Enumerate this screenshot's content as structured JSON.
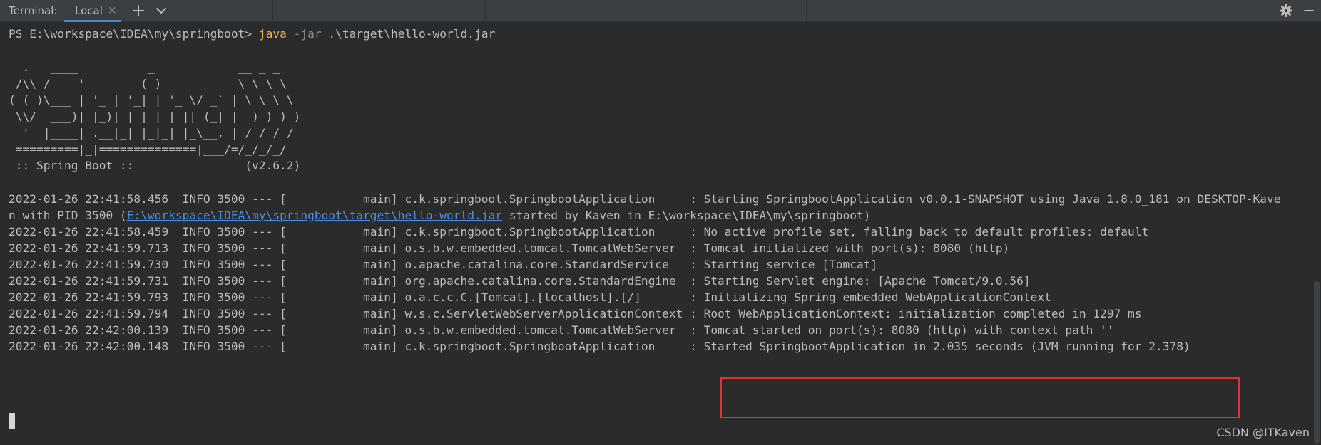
{
  "header": {
    "title": "Terminal:",
    "tab_label": "Local",
    "tab_close_glyph": "×",
    "icons": {
      "add": "plus-icon",
      "dropdown": "chevron-down-icon",
      "settings": "gear-icon",
      "minimize": "minimize-icon"
    },
    "accent_color": "#4a88c7"
  },
  "terminal": {
    "prompt": "PS E:\\workspace\\IDEA\\my\\springboot> ",
    "cmd_java": "java",
    "cmd_flag": " -jar",
    "cmd_arg": " .\\target\\hello-world.jar",
    "banner": [
      "  .   ____          _            __ _ _",
      " /\\\\ / ___'_ __ _ _(_)_ __  __ _ \\ \\ \\ \\",
      "( ( )\\___ | '_ | '_| | '_ \\/ _` | \\ \\ \\ \\",
      " \\\\/  ___)| |_)| | | | | || (_| |  ) ) ) )",
      "  '  |____| .__|_| |_|_| |_\\__, | / / / /",
      " =========|_|==============|___/=/_/_/_/",
      " :: Spring Boot ::                (v2.6.2)"
    ],
    "log_line_1_prefix": "2022-01-26 22:41:58.456  INFO 3500 --- [           main] c.k.springboot.SpringbootApplication     : Starting SpringbootApplication v0.0.1-SNAPSHOT using Java 1.8.0_181 on DESKTOP-Kave",
    "log_line_1_wrap_a": "n with PID 3500 (",
    "log_line_1_link": "E:\\workspace\\IDEA\\my\\springboot\\target\\hello-world.jar",
    "log_line_1_wrap_b": " started by Kaven in E:\\workspace\\IDEA\\my\\springboot)",
    "logs": [
      "2022-01-26 22:41:58.459  INFO 3500 --- [           main] c.k.springboot.SpringbootApplication     : No active profile set, falling back to default profiles: default",
      "2022-01-26 22:41:59.713  INFO 3500 --- [           main] o.s.b.w.embedded.tomcat.TomcatWebServer  : Tomcat initialized with port(s): 8080 (http)",
      "2022-01-26 22:41:59.730  INFO 3500 --- [           main] o.apache.catalina.core.StandardService   : Starting service [Tomcat]",
      "2022-01-26 22:41:59.731  INFO 3500 --- [           main] org.apache.catalina.core.StandardEngine  : Starting Servlet engine: [Apache Tomcat/9.0.56]",
      "2022-01-26 22:41:59.793  INFO 3500 --- [           main] o.a.c.c.C.[Tomcat].[localhost].[/]       : Initializing Spring embedded WebApplicationContext",
      "2022-01-26 22:41:59.794  INFO 3500 --- [           main] w.s.c.ServletWebServerApplicationContext : Root WebApplicationContext: initialization completed in 1297 ms",
      "2022-01-26 22:42:00.139  INFO 3500 --- [           main] o.s.b.w.embedded.tomcat.TomcatWebServer  : Tomcat started on port(s): 8080 (http) with context path ''",
      "2022-01-26 22:42:00.148  INFO 3500 --- [           main] c.k.springboot.SpringbootApplication     : Started SpringbootApplication in 2.035 seconds (JVM running for 2.378)"
    ]
  },
  "colors": {
    "background": "#2b2b2b",
    "text": "#bbbbbb",
    "command": "#e6b450",
    "link": "#4b8ee8",
    "highlight": "#e0322f"
  },
  "watermark": "CSDN @ITKaven"
}
